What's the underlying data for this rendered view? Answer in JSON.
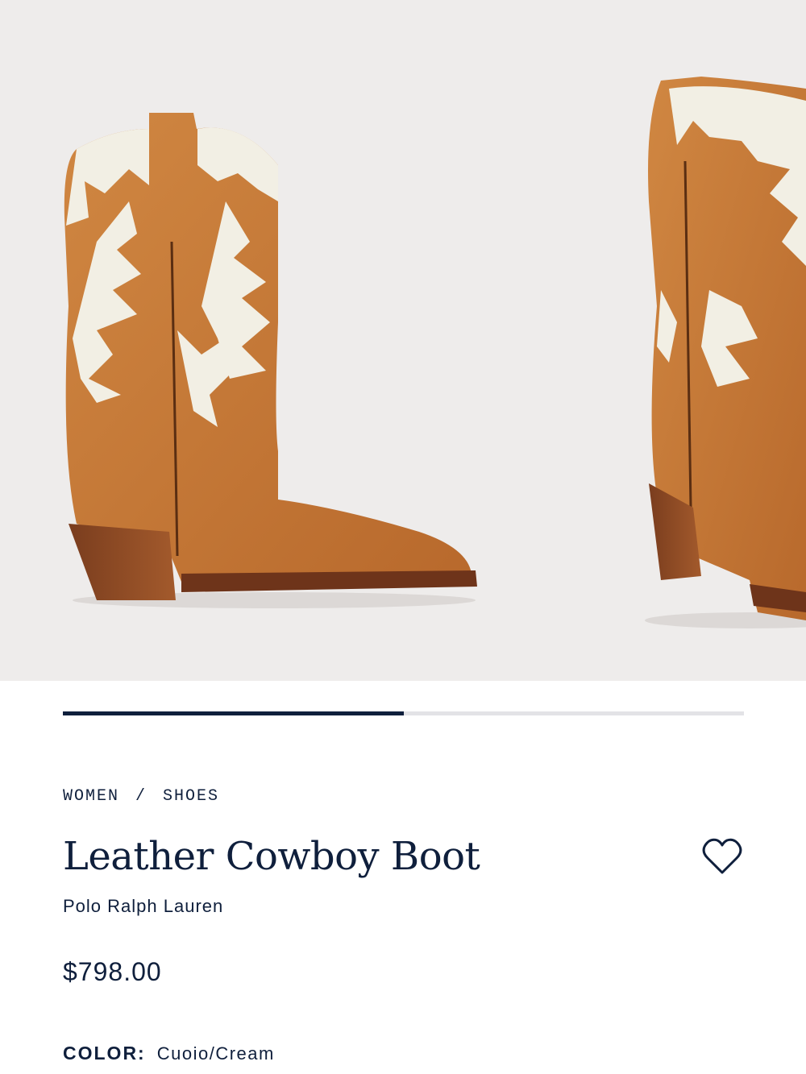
{
  "gallery": {
    "images": [
      "product-image-side-view",
      "product-image-angle-view"
    ],
    "progress": 0.5
  },
  "breadcrumb": {
    "items": [
      "WOMEN",
      "SHOES"
    ],
    "separator": "/"
  },
  "product": {
    "title": "Leather Cowboy Boot",
    "brand": "Polo Ralph Lauren",
    "price": "$798.00",
    "color_label": "COLOR:",
    "color_value": "Cuoio/Cream"
  },
  "icons": {
    "wishlist": "heart-icon"
  },
  "colors": {
    "navy": "#0f1f3c",
    "leather": "#c97a3a",
    "cream": "#f2efe4",
    "background": "#eeeceb"
  }
}
